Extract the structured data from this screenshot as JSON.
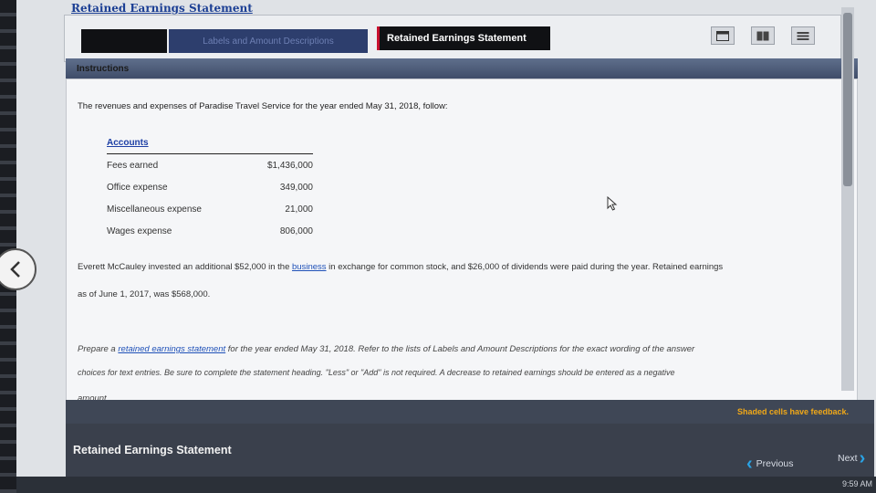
{
  "app": {
    "title": "Retained Earnings Statement"
  },
  "tabs": {
    "blank_label": "",
    "labels_tab": "Labels and Amount Descriptions",
    "active_tab": "Retained Earnings Statement"
  },
  "instructions": {
    "header": "Instructions",
    "intro": "The revenues and expenses of Paradise Travel Service for the year ended May 31, 2018, follow:",
    "accounts_header": "Accounts",
    "accounts": [
      {
        "name": "Fees earned",
        "amount": "$1,436,000"
      },
      {
        "name": "Office expense",
        "amount": "349,000"
      },
      {
        "name": "Miscellaneous expense",
        "amount": "21,000"
      },
      {
        "name": "Wages expense",
        "amount": "806,000"
      }
    ],
    "para1_a": "Everett McCauley invested an additional $52,000 in the ",
    "para1_link": "business",
    "para1_b": " in exchange for common stock, and $26,000 of dividends were paid during the year. Retained earnings",
    "para1_line2": "as of June 1, 2017, was $568,000.",
    "para2_a": "Prepare a ",
    "para2_link": "retained earnings statement",
    "para2_b": " for the year ended May 31, 2018. Refer to the lists of Labels and Amount Descriptions for the exact wording of the answer",
    "para2_line2": "choices for text entries. Be sure to complete the statement heading. \"Less\" or \"Add\" is not required. A decrease to retained earnings should be entered as a negative",
    "para2_line3": "amount."
  },
  "feedback": {
    "note": "Shaded cells have feedback."
  },
  "bottom": {
    "section_title": "Retained Earnings Statement"
  },
  "nav": {
    "previous": "Previous",
    "next": "Next"
  },
  "taskbar": {
    "clock": "9:59 AM"
  },
  "colors": {
    "accent_blue": "#2aa4e6",
    "feedback_orange": "#f0a818",
    "link_blue": "#1f51b8"
  }
}
